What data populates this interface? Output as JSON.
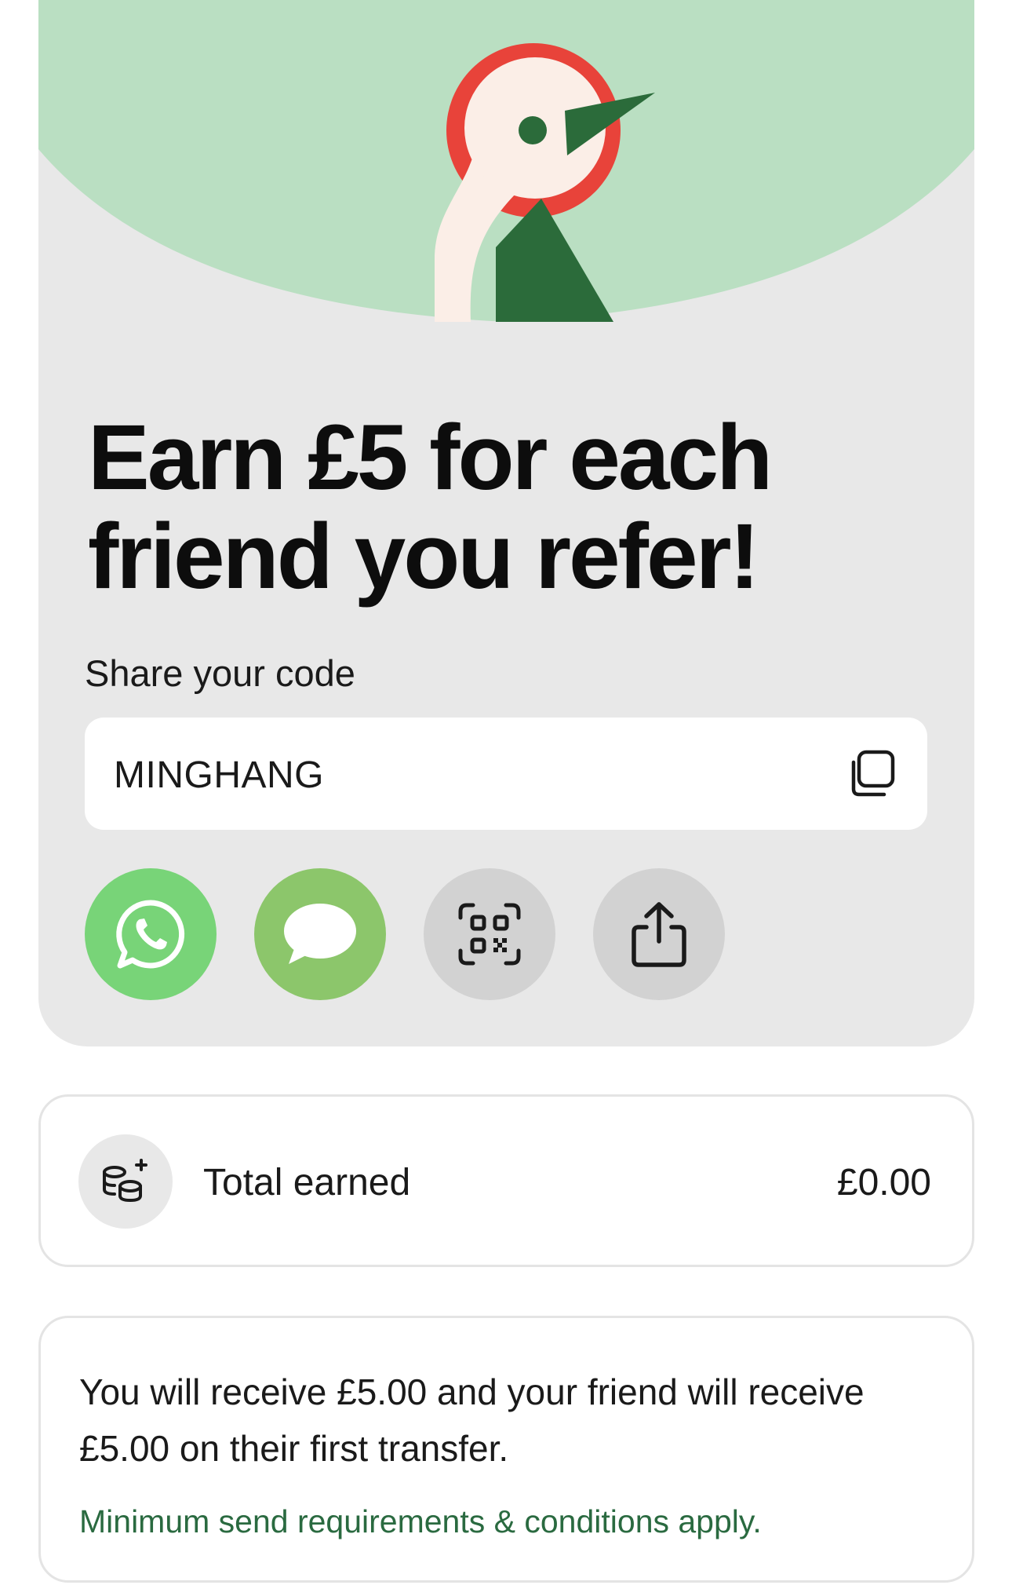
{
  "hero": {
    "illustration": "woodpecker-bird-illustration",
    "headline_line1": "Earn £5 for each",
    "headline_line2": "friend you refer!"
  },
  "share": {
    "label": "Share your code",
    "code": "MINGHANG",
    "copy_icon": "copy-icon",
    "buttons": [
      {
        "name": "whatsapp",
        "icon": "whatsapp-icon",
        "color": "#78d478"
      },
      {
        "name": "messages",
        "icon": "message-bubble-icon",
        "color": "#8cc66b"
      },
      {
        "name": "qr-code",
        "icon": "qr-code-icon",
        "color": "#d2d2d2"
      },
      {
        "name": "share",
        "icon": "share-icon",
        "color": "#d2d2d2"
      }
    ]
  },
  "earned": {
    "icon": "coins-icon",
    "label": "Total earned",
    "value": "£0.00"
  },
  "info": {
    "text": "You will receive £5.00 and your friend will receive £5.00 on their first transfer.",
    "terms_link": "Minimum send requirements & conditions apply."
  },
  "colors": {
    "hero_green": "#badfc2",
    "card_grey": "#e8e8e8",
    "bird_red": "#e8433a",
    "bird_dark_green": "#2b6b3a",
    "bird_cream": "#fbeee7",
    "link_green": "#2a6a40"
  }
}
